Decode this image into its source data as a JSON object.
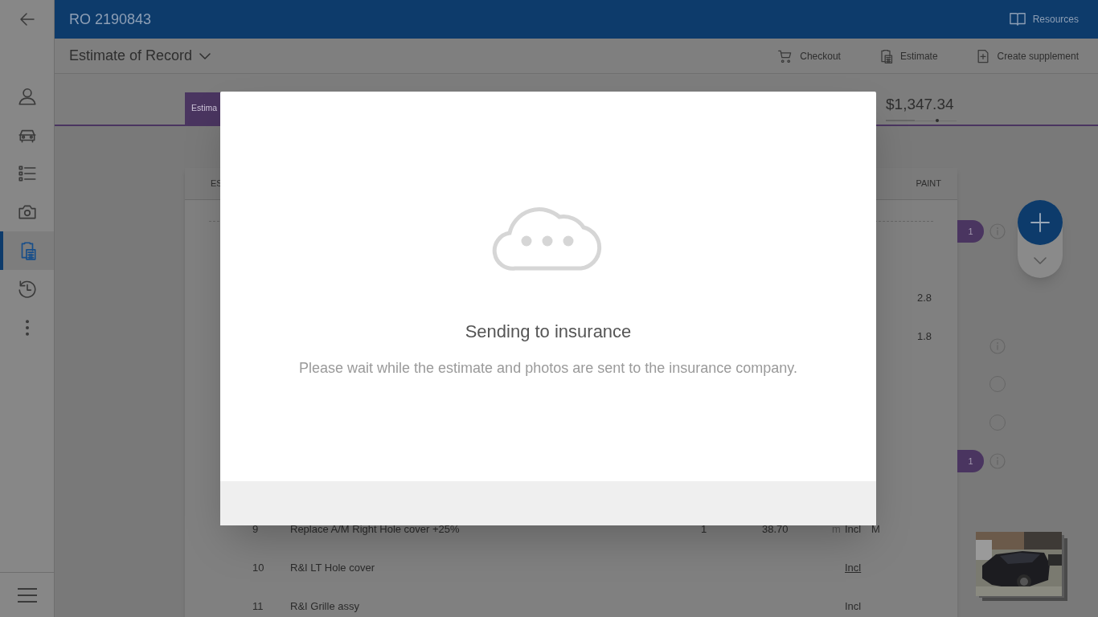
{
  "header": {
    "title": "RO 2190843",
    "resources": "Resources"
  },
  "sidebar": {
    "items": [
      {
        "kind": "person",
        "selected": false
      },
      {
        "kind": "car",
        "selected": false
      },
      {
        "kind": "checklist",
        "selected": false
      },
      {
        "kind": "camera",
        "selected": false
      },
      {
        "kind": "estimate",
        "selected": true
      },
      {
        "kind": "history",
        "selected": false
      },
      {
        "kind": "more",
        "selected": false
      }
    ]
  },
  "toolbar": {
    "view": "Estimate of Record",
    "actions": [
      {
        "kind": "cart",
        "label": "Checkout"
      },
      {
        "kind": "estimate",
        "label": "Estimate"
      },
      {
        "kind": "supplement",
        "label": "Create supplement"
      }
    ]
  },
  "summary": {
    "tab": "Estima",
    "total": "$1,347.34"
  },
  "table": {
    "columns": [
      "ES",
      "PAINT"
    ],
    "groups": [
      {
        "rows": [
          {
            "paint": "2.8"
          },
          {
            "paint": "1.8"
          }
        ]
      },
      {
        "rows": [
          {
            "line": "9",
            "description": "Replace A/M Right Hole cover +25%",
            "qty": "1",
            "price": "38.70",
            "flag": "m",
            "labor": "Incl",
            "paint_flag": "M"
          },
          {
            "line": "10",
            "description": "R&I LT Hole cover",
            "labor": "Incl",
            "link": true
          },
          {
            "line": "11",
            "description": "R&I Grille assy",
            "labor": "Incl",
            "link": false
          }
        ]
      }
    ]
  },
  "markers": [
    {
      "kind": "badge",
      "count": "1"
    },
    {
      "kind": "info"
    },
    {
      "kind": "circle"
    },
    {
      "kind": "circle"
    },
    {
      "kind": "badge",
      "count": "1"
    }
  ],
  "dialog": {
    "title": "Sending to insurance",
    "message": "Please wait while the estimate and photos are sent to the insurance company."
  }
}
